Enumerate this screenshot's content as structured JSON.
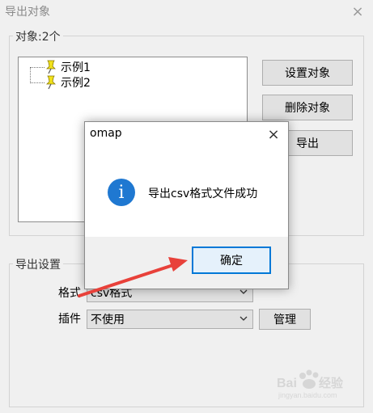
{
  "window": {
    "title": "导出对象",
    "close_glyph": "×"
  },
  "objects_group": {
    "title": "对象:2个",
    "items": [
      {
        "label": "示例1"
      },
      {
        "label": "示例2"
      }
    ]
  },
  "buttons": {
    "set_object": "设置对象",
    "delete_object": "删除对象",
    "export": "导出"
  },
  "export_settings": {
    "title": "导出设置",
    "format_label": "格式",
    "format_value": "csv格式",
    "plugin_label": "插件",
    "plugin_value": "不使用",
    "manage_button": "管理"
  },
  "dialog": {
    "title": "omap",
    "close_glyph": "×",
    "icon": "info-icon",
    "icon_glyph": "i",
    "message": "导出csv格式文件成功",
    "ok_button": "确定"
  },
  "colors": {
    "accent": "#0078d7",
    "info_blue": "#1f78d1",
    "arrow_red": "#e8413a"
  },
  "watermark": {
    "text": "Bai经验",
    "url": "jingyan.baidu.com"
  }
}
